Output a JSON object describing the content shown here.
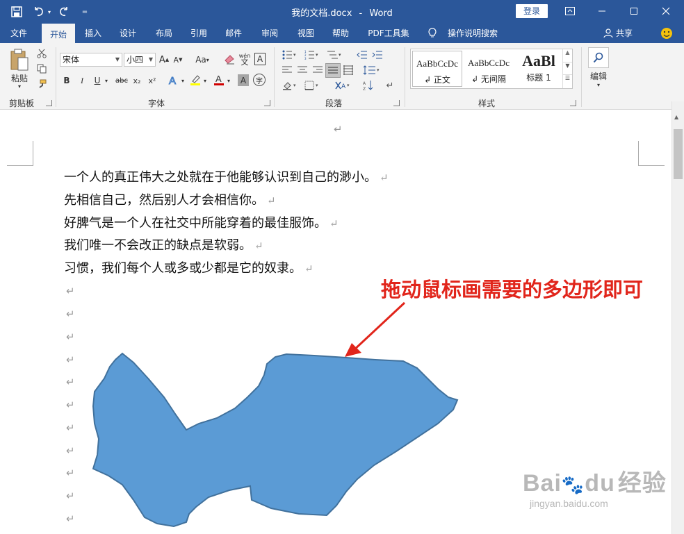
{
  "app": {
    "document_title": "我的文档.docx",
    "separator": "-",
    "app_name": "Word",
    "login_label": "登录"
  },
  "menu": {
    "tabs": [
      "文件",
      "开始",
      "插入",
      "设计",
      "布局",
      "引用",
      "邮件",
      "审阅",
      "视图",
      "帮助",
      "PDF工具集"
    ],
    "active_tab": "开始",
    "search_label": "操作说明搜索",
    "share_label": "共享"
  },
  "ribbon": {
    "clipboard": {
      "label": "剪贴板",
      "paste_label": "粘贴"
    },
    "font": {
      "label": "字体",
      "font_name": "宋体",
      "font_size": "小四",
      "change_case": "Aa",
      "phonetic": "wén",
      "char_border": "A",
      "bold": "B",
      "italic": "I",
      "underline": "U",
      "strike": "abc",
      "subscript": "x₂",
      "superscript": "x²",
      "highlight_char": "A"
    },
    "paragraph": {
      "label": "段落"
    },
    "styles": {
      "label": "样式",
      "items": [
        {
          "preview": "AaBbCcDc",
          "name": "↲ 正文"
        },
        {
          "preview": "AaBbCcDc",
          "name": "↲ 无间隔"
        },
        {
          "preview": "AaBl",
          "name": "标题 1"
        }
      ]
    },
    "editing": {
      "label": "编辑"
    }
  },
  "document": {
    "top_mark": "↵",
    "paragraphs": [
      "一个人的真正伟大之处就在于他能够认识到自己的渺小。",
      "先相信自己，然后别人才会相信你。",
      "好脾气是一个人在社交中所能穿着的最佳服饰。",
      "我们唯一不会改正的缺点是软弱。",
      "习惯，我们每个人或多或少都是它的奴隶。"
    ],
    "paragraph_mark": "↵",
    "empty_paragraph_count": 11,
    "shape": {
      "type": "freeform polygon",
      "fill": "#5b9bd5",
      "stroke": "#41719c"
    }
  },
  "annotation": {
    "text": "拖动鼠标画需要的多边形即可",
    "color": "#e1251b"
  },
  "watermark": {
    "brand": "Bai",
    "brand2": "du",
    "cn": "经验",
    "url": "jingyan.baidu.com"
  },
  "colors": {
    "accent": "#2b579a",
    "ribbon_bg": "#f3f3f3"
  }
}
